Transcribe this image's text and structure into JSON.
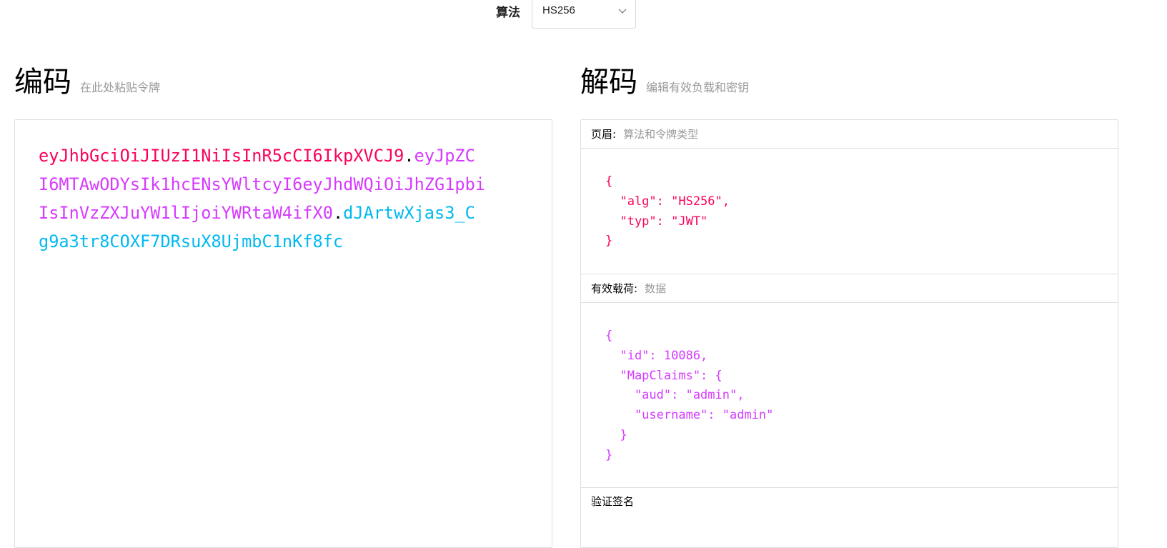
{
  "algorithm": {
    "label": "算法",
    "selected": "HS256"
  },
  "encoded": {
    "title": "编码",
    "subtitle": "在此处粘贴令牌",
    "token_header": "eyJhbGciOiJIUzI1NiIsInR5cCI6IkpXVCJ9",
    "token_payload": "eyJpZCI6MTAwODYsIk1hcENsYWltcyI6eyJhdWQiOiJhZG1pbiIsInVzZXJuYW1lIjoiYWRtaW4ifX0",
    "token_signature": "dJArtwXjas3_Cg9a3tr8COXF7DRsuX8UjmbC1nKf8fc",
    "dot": "."
  },
  "decoded": {
    "title": "解码",
    "subtitle": "编辑有效负载和密钥",
    "header_section": {
      "title": "页眉:",
      "hint": "算法和令牌类型"
    },
    "header_json": "{\n  \"alg\": \"HS256\",\n  \"typ\": \"JWT\"\n}",
    "payload_section": {
      "title": "有效载荷:",
      "hint": "数据"
    },
    "payload_json": "{\n  \"id\": 10086,\n  \"MapClaims\": {\n    \"aud\": \"admin\",\n    \"username\": \"admin\"\n  }\n}",
    "signature_section": {
      "title": "验证签名"
    }
  },
  "colors": {
    "header": "#fb015b",
    "payload": "#d63aff",
    "signature": "#00b9f1"
  }
}
